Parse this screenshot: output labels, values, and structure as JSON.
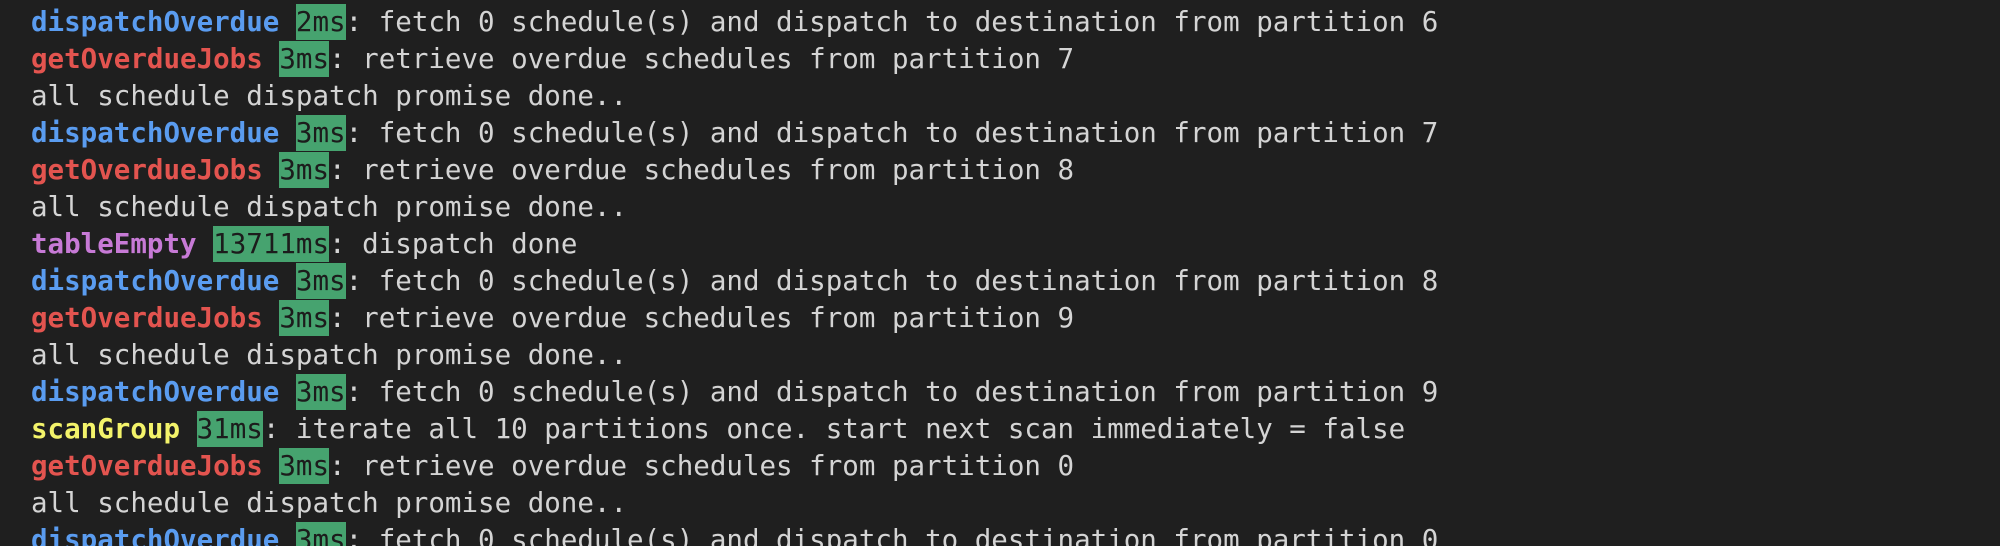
{
  "colors": {
    "background": "#1f1f1f",
    "text": "#d4d4d4",
    "duration_bg": "#46a36f",
    "dispatchOverdue": "#5a9cf0",
    "getOverdueJobs": "#e3544f",
    "tableEmpty": "#c77ad6",
    "scanGroup": "#f3f36a"
  },
  "lines": [
    {
      "type": "tagged",
      "tag": "dispatchOverdue",
      "color": "#5a9cf0",
      "duration": "2ms",
      "message": ": fetch 0 schedule(s) and dispatch to destination from partition 6"
    },
    {
      "type": "tagged",
      "tag": "getOverdueJobs",
      "color": "#e3544f",
      "duration": "3ms",
      "message": ": retrieve overdue schedules from partition 7"
    },
    {
      "type": "plain",
      "message": "all schedule dispatch promise done.."
    },
    {
      "type": "tagged",
      "tag": "dispatchOverdue",
      "color": "#5a9cf0",
      "duration": "3ms",
      "message": ": fetch 0 schedule(s) and dispatch to destination from partition 7"
    },
    {
      "type": "tagged",
      "tag": "getOverdueJobs",
      "color": "#e3544f",
      "duration": "3ms",
      "message": ": retrieve overdue schedules from partition 8"
    },
    {
      "type": "plain",
      "message": "all schedule dispatch promise done.."
    },
    {
      "type": "tagged",
      "tag": "tableEmpty",
      "color": "#c77ad6",
      "duration": "13711ms",
      "message": ": dispatch done"
    },
    {
      "type": "tagged",
      "tag": "dispatchOverdue",
      "color": "#5a9cf0",
      "duration": "3ms",
      "message": ": fetch 0 schedule(s) and dispatch to destination from partition 8"
    },
    {
      "type": "tagged",
      "tag": "getOverdueJobs",
      "color": "#e3544f",
      "duration": "3ms",
      "message": ": retrieve overdue schedules from partition 9"
    },
    {
      "type": "plain",
      "message": "all schedule dispatch promise done.."
    },
    {
      "type": "tagged",
      "tag": "dispatchOverdue",
      "color": "#5a9cf0",
      "duration": "3ms",
      "message": ": fetch 0 schedule(s) and dispatch to destination from partition 9"
    },
    {
      "type": "tagged",
      "tag": "scanGroup",
      "color": "#f3f36a",
      "duration": "31ms",
      "message": ": iterate all 10 partitions once. start next scan immediately = false"
    },
    {
      "type": "tagged",
      "tag": "getOverdueJobs",
      "color": "#e3544f",
      "duration": "3ms",
      "message": ": retrieve overdue schedules from partition 0"
    },
    {
      "type": "plain",
      "message": "all schedule dispatch promise done.."
    },
    {
      "type": "tagged",
      "tag": "dispatchOverdue",
      "color": "#5a9cf0",
      "duration": "3ms",
      "message": ": fetch 0 schedule(s) and dispatch to destination from partition 0"
    }
  ]
}
